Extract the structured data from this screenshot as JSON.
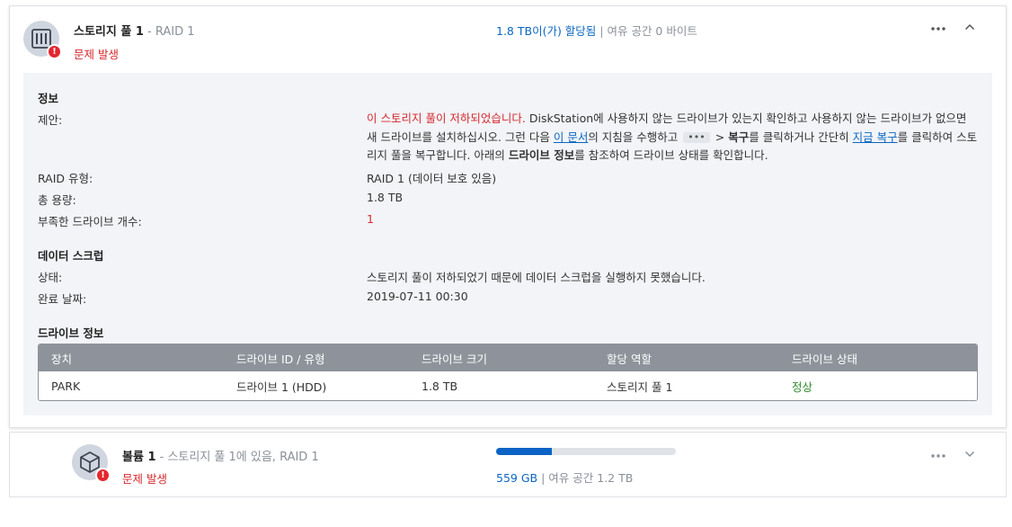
{
  "pool": {
    "title": "스토리지 풀 1",
    "subtitle": "- RAID 1",
    "problem": "문제 발생",
    "allocated": "1.8 TB이(가) 할당됨",
    "separator": "|",
    "free_label": "여유 공간 0 바이트"
  },
  "info": {
    "section_title": "정보",
    "suggest_label": "제안:",
    "suggest_red": "이 스토리지 풀이 저하되었습니다.",
    "suggest_p1": " DiskStation에 사용하지 않는 드라이브가 있는지 확인하고 사용하지 않는 드라이브가 없으면 새 드라이브를 설치하십시오. 그런 다음 ",
    "suggest_link1": "이 문서",
    "suggest_p2": "의 지침을 수행하고",
    "suggest_dots": "•••",
    "suggest_p3": "> ",
    "suggest_bold1": "복구",
    "suggest_p4": "를 클릭하거나 간단히 ",
    "suggest_link2": "지금 복구",
    "suggest_p5": "를 클릭하여 스토리지 풀을 복구합니다. 아래의 ",
    "suggest_bold2": "드라이브 정보",
    "suggest_p6": "를 참조하여 드라이브 상태를 확인합니다.",
    "raid_label": "RAID 유형:",
    "raid_value": "RAID 1 (데이터 보호 있음)",
    "capacity_label": "총 용량:",
    "capacity_value": "1.8 TB",
    "missing_label": "부족한 드라이브 개수:",
    "missing_value": "1"
  },
  "scrub": {
    "section_title": "데이터 스크럽",
    "status_label": "상태:",
    "status_value": "스토리지 풀이 저하되었기 때문에 데이터 스크럽을 실행하지 못했습니다.",
    "date_label": "완료 날짜:",
    "date_value": "2019-07-11 00:30"
  },
  "drives": {
    "section_title": "드라이브 정보",
    "headers": [
      "장치",
      "드라이브 ID / 유형",
      "드라이브 크기",
      "할당 역할",
      "드라이브 상태"
    ],
    "rows": [
      [
        "PARK",
        "드라이브 1 (HDD)",
        "1.8 TB",
        "스토리지 풀 1",
        "정상"
      ]
    ]
  },
  "volume": {
    "title": "볼륨 1",
    "subtitle": "- 스토리지 풀 1에 있음, RAID 1",
    "problem": "문제 발생",
    "used": "559 GB",
    "separator": "|",
    "free_label": "여유 공간 1.2 TB",
    "usage_fraction": 0.31
  },
  "colors": {
    "accent": "#0a66c2",
    "error": "#d7282f",
    "ok": "#2e8b2e",
    "table_header": "#8e939b"
  },
  "icons": {
    "pool": "storage-pool-icon",
    "volume": "volume-cube-icon",
    "error": "error-badge-icon",
    "more": "more-dots-icon",
    "collapse": "chevron-up-icon",
    "expand": "chevron-down-icon"
  }
}
